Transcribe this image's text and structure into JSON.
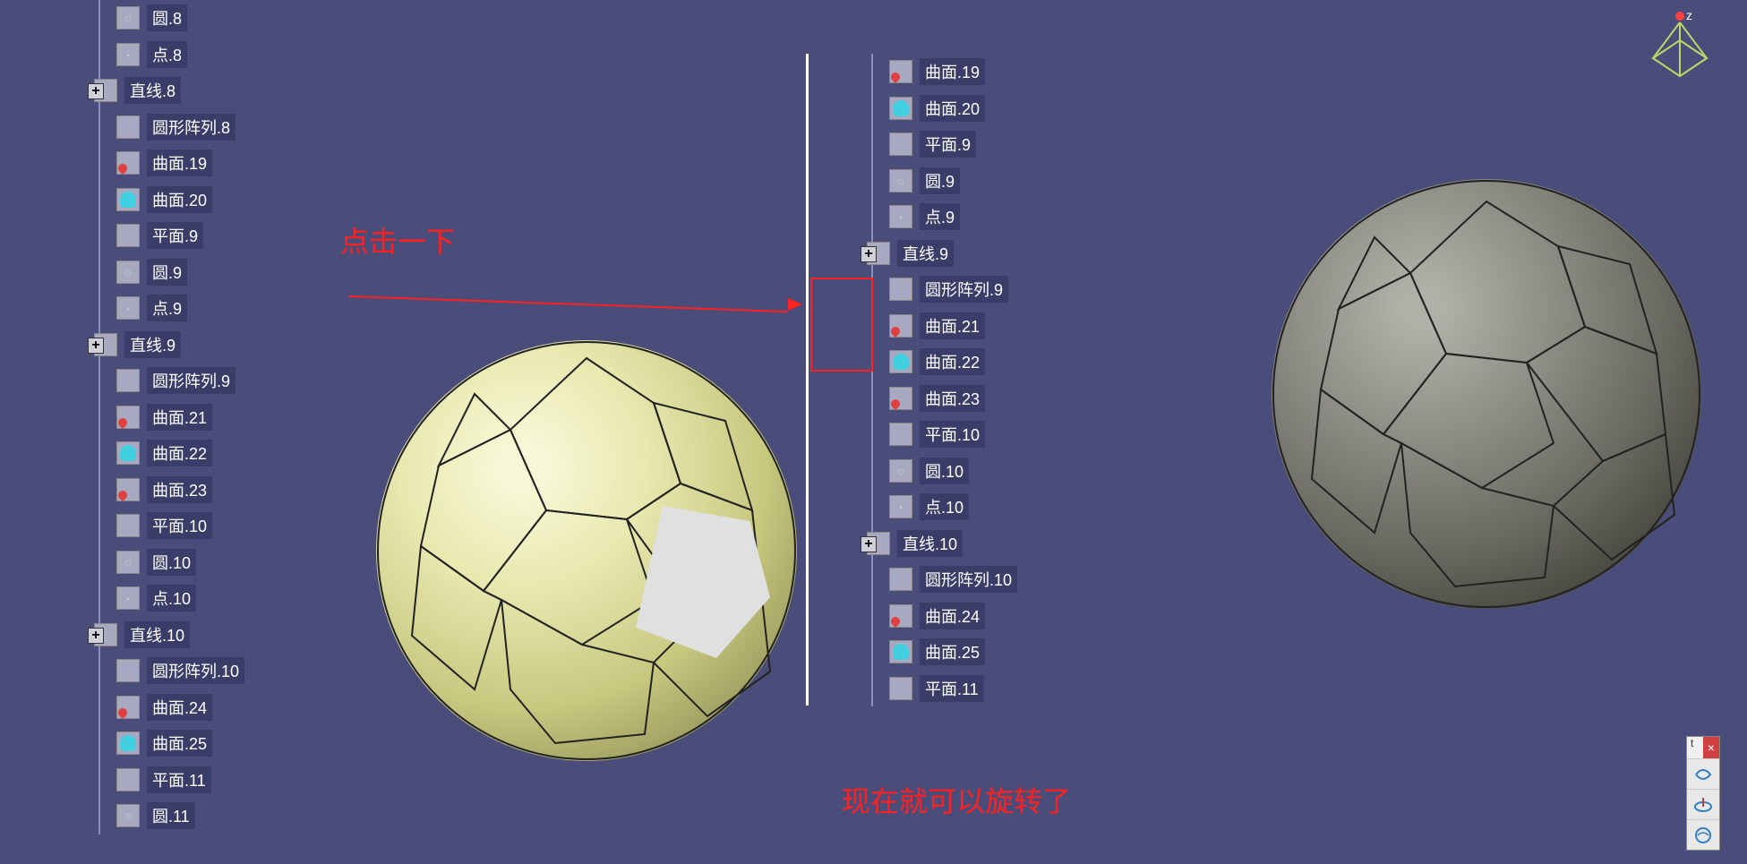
{
  "annotations": {
    "click_label": "点击一下",
    "rotate_label": "现在就可以旋转了"
  },
  "compass": {
    "axis_z": "z"
  },
  "toolbar": {
    "close": "×",
    "label": "t"
  },
  "tree_left": [
    {
      "icon": "ic-circle",
      "label": "圆.8",
      "indent": 2
    },
    {
      "icon": "ic-point",
      "label": "点.8",
      "indent": 2
    },
    {
      "icon": "ic-line",
      "label": "直线.8",
      "indent": 1,
      "expand": "+"
    },
    {
      "icon": "ic-pattern",
      "label": "圆形阵列.8",
      "indent": 2
    },
    {
      "icon": "ic-surface-red",
      "label": "曲面.19",
      "indent": 2
    },
    {
      "icon": "ic-surface-cyan",
      "label": "曲面.20",
      "indent": 2
    },
    {
      "icon": "ic-plane",
      "label": "平面.9",
      "indent": 2
    },
    {
      "icon": "ic-circle",
      "label": "圆.9",
      "indent": 2
    },
    {
      "icon": "ic-point",
      "label": "点.9",
      "indent": 2
    },
    {
      "icon": "ic-line",
      "label": "直线.9",
      "indent": 1,
      "expand": "+"
    },
    {
      "icon": "ic-pattern",
      "label": "圆形阵列.9",
      "indent": 2
    },
    {
      "icon": "ic-surface-red",
      "label": "曲面.21",
      "indent": 2
    },
    {
      "icon": "ic-surface-cyan",
      "label": "曲面.22",
      "indent": 2
    },
    {
      "icon": "ic-surface-red",
      "label": "曲面.23",
      "indent": 2
    },
    {
      "icon": "ic-plane",
      "label": "平面.10",
      "indent": 2
    },
    {
      "icon": "ic-circle",
      "label": "圆.10",
      "indent": 2
    },
    {
      "icon": "ic-point",
      "label": "点.10",
      "indent": 2
    },
    {
      "icon": "ic-line",
      "label": "直线.10",
      "indent": 1,
      "expand": "+"
    },
    {
      "icon": "ic-pattern",
      "label": "圆形阵列.10",
      "indent": 2
    },
    {
      "icon": "ic-surface-red",
      "label": "曲面.24",
      "indent": 2
    },
    {
      "icon": "ic-surface-cyan",
      "label": "曲面.25",
      "indent": 2
    },
    {
      "icon": "ic-plane",
      "label": "平面.11",
      "indent": 2
    },
    {
      "icon": "ic-circle",
      "label": "圆.11",
      "indent": 2
    }
  ],
  "tree_right": [
    {
      "icon": "ic-surface-red",
      "label": "曲面.19",
      "indent": 2
    },
    {
      "icon": "ic-surface-cyan",
      "label": "曲面.20",
      "indent": 2
    },
    {
      "icon": "ic-plane",
      "label": "平面.9",
      "indent": 2
    },
    {
      "icon": "ic-circle",
      "label": "圆.9",
      "indent": 2
    },
    {
      "icon": "ic-point",
      "label": "点.9",
      "indent": 2
    },
    {
      "icon": "ic-line",
      "label": "直线.9",
      "indent": 1,
      "expand": "+"
    },
    {
      "icon": "ic-pattern",
      "label": "圆形阵列.9",
      "indent": 2
    },
    {
      "icon": "ic-surface-red",
      "label": "曲面.21",
      "indent": 2
    },
    {
      "icon": "ic-surface-cyan",
      "label": "曲面.22",
      "indent": 2
    },
    {
      "icon": "ic-surface-red",
      "label": "曲面.23",
      "indent": 2
    },
    {
      "icon": "ic-plane",
      "label": "平面.10",
      "indent": 2
    },
    {
      "icon": "ic-circle",
      "label": "圆.10",
      "indent": 2
    },
    {
      "icon": "ic-point",
      "label": "点.10",
      "indent": 2
    },
    {
      "icon": "ic-line",
      "label": "直线.10",
      "indent": 1,
      "expand": "+"
    },
    {
      "icon": "ic-pattern",
      "label": "圆形阵列.10",
      "indent": 2
    },
    {
      "icon": "ic-surface-red",
      "label": "曲面.24",
      "indent": 2
    },
    {
      "icon": "ic-surface-cyan",
      "label": "曲面.25",
      "indent": 2
    },
    {
      "icon": "ic-plane",
      "label": "平面.11",
      "indent": 2
    }
  ]
}
